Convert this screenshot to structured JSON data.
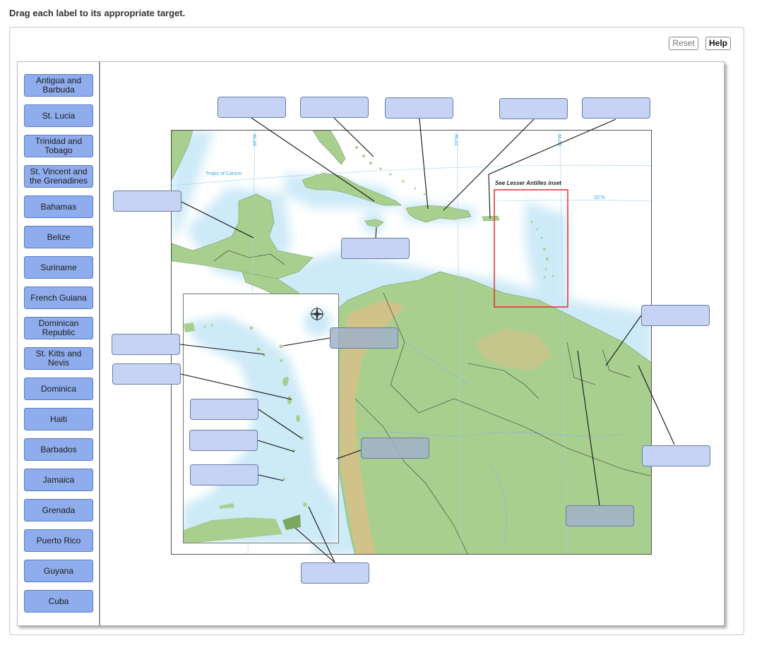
{
  "instruction": "Drag each label to its appropriate target.",
  "toolbar": {
    "reset_label": "Reset",
    "help_label": "Help"
  },
  "labels": [
    "Antigua and\nBarbuda",
    "St. Lucia",
    "Trinidad and\nTobago",
    "St. Vincent and\nthe Grenadines",
    "Bahamas",
    "Belize",
    "Suriname",
    "French Guiana",
    "Dominican\nRepublic",
    "St. Kitts and\nNevis",
    "Dominica",
    "Haiti",
    "Barbados",
    "Jamaica",
    "Grenada",
    "Puerto Rico",
    "Guyana",
    "Cuba"
  ],
  "map": {
    "inset_note": "See Lesser Antilles inset",
    "tropic_label": "Tropic of Cancer",
    "lat_label": "20°N",
    "lon_labels": [
      "90°W",
      "70°W",
      "60°W"
    ],
    "colors": {
      "water": "#ffffff",
      "shallow_water": "#cdeaf7",
      "land": "#a9cf8f",
      "highland": "#d8c08a",
      "inset_box": "#e02020",
      "target_fill": "#c6d3f4",
      "label_fill": "#8fadec"
    }
  }
}
